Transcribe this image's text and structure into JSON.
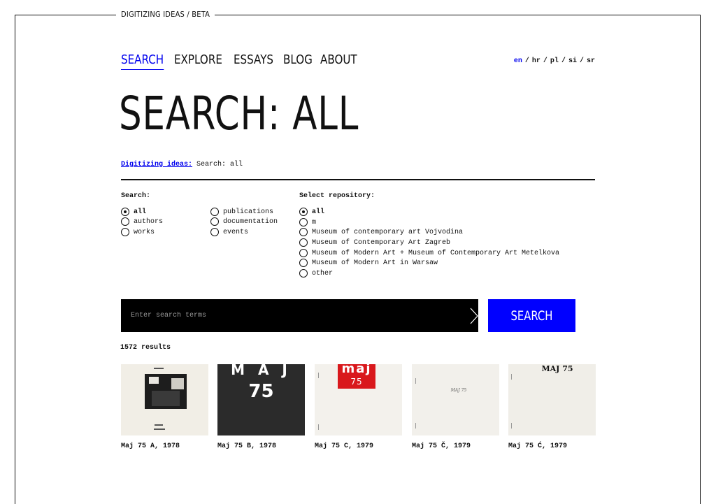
{
  "site": {
    "tag": "DIGITIZING IDEAS / BETA"
  },
  "nav": {
    "items": [
      {
        "label": "SEARCH",
        "active": true
      },
      {
        "label": "EXPLORE",
        "active": false
      },
      {
        "label": "ESSAYS",
        "active": false
      },
      {
        "label": "BLOG",
        "active": false
      },
      {
        "label": "ABOUT",
        "active": false
      }
    ]
  },
  "languages": {
    "selected": "en",
    "items": [
      "en",
      "hr",
      "pl",
      "si",
      "sr"
    ]
  },
  "page": {
    "title": "SEARCH: ALL",
    "breadcrumb": {
      "link": "Digitizing ideas:",
      "current": "Search: all"
    }
  },
  "filters": {
    "search_label": "Search:",
    "search_options": [
      {
        "label": "all",
        "checked": true
      },
      {
        "label": "authors",
        "checked": false
      },
      {
        "label": "works",
        "checked": false
      },
      {
        "label": "publications",
        "checked": false
      },
      {
        "label": "documentation",
        "checked": false
      },
      {
        "label": "events",
        "checked": false
      }
    ],
    "repo_label": "Select repository:",
    "repo_options": [
      {
        "label": "all",
        "checked": true
      },
      {
        "label": "m",
        "checked": false
      },
      {
        "label": "Museum of contemporary art Vojvodina",
        "checked": false
      },
      {
        "label": "Museum of Contemporary Art Zagreb",
        "checked": false
      },
      {
        "label": "Museum of Modern Art + Museum of Contemporary Art Metelkova",
        "checked": false
      },
      {
        "label": "Museum of Modern Art in Warsaw",
        "checked": false
      },
      {
        "label": "other",
        "checked": false
      }
    ]
  },
  "search": {
    "placeholder": "Enter search terms",
    "value": "",
    "button_label": "SEARCH"
  },
  "results": {
    "count_text": "1572 results",
    "items": [
      {
        "title": "Maj 75 A, 1978"
      },
      {
        "title": "Maj 75 B, 1978",
        "cover_text_top": "M A J",
        "cover_text_bottom": "75"
      },
      {
        "title": "Maj 75 C, 1979",
        "cover_text_top": "maj",
        "cover_text_bottom": "75"
      },
      {
        "title": "Maj 75 Č, 1979",
        "cover_text_top": "MAJ 75"
      },
      {
        "title": "Maj 75 Ć, 1979",
        "cover_text_top": "MAJ 75"
      }
    ]
  },
  "colors": {
    "accent": "#0000ff",
    "link": "#0000ee",
    "text": "#111111"
  }
}
